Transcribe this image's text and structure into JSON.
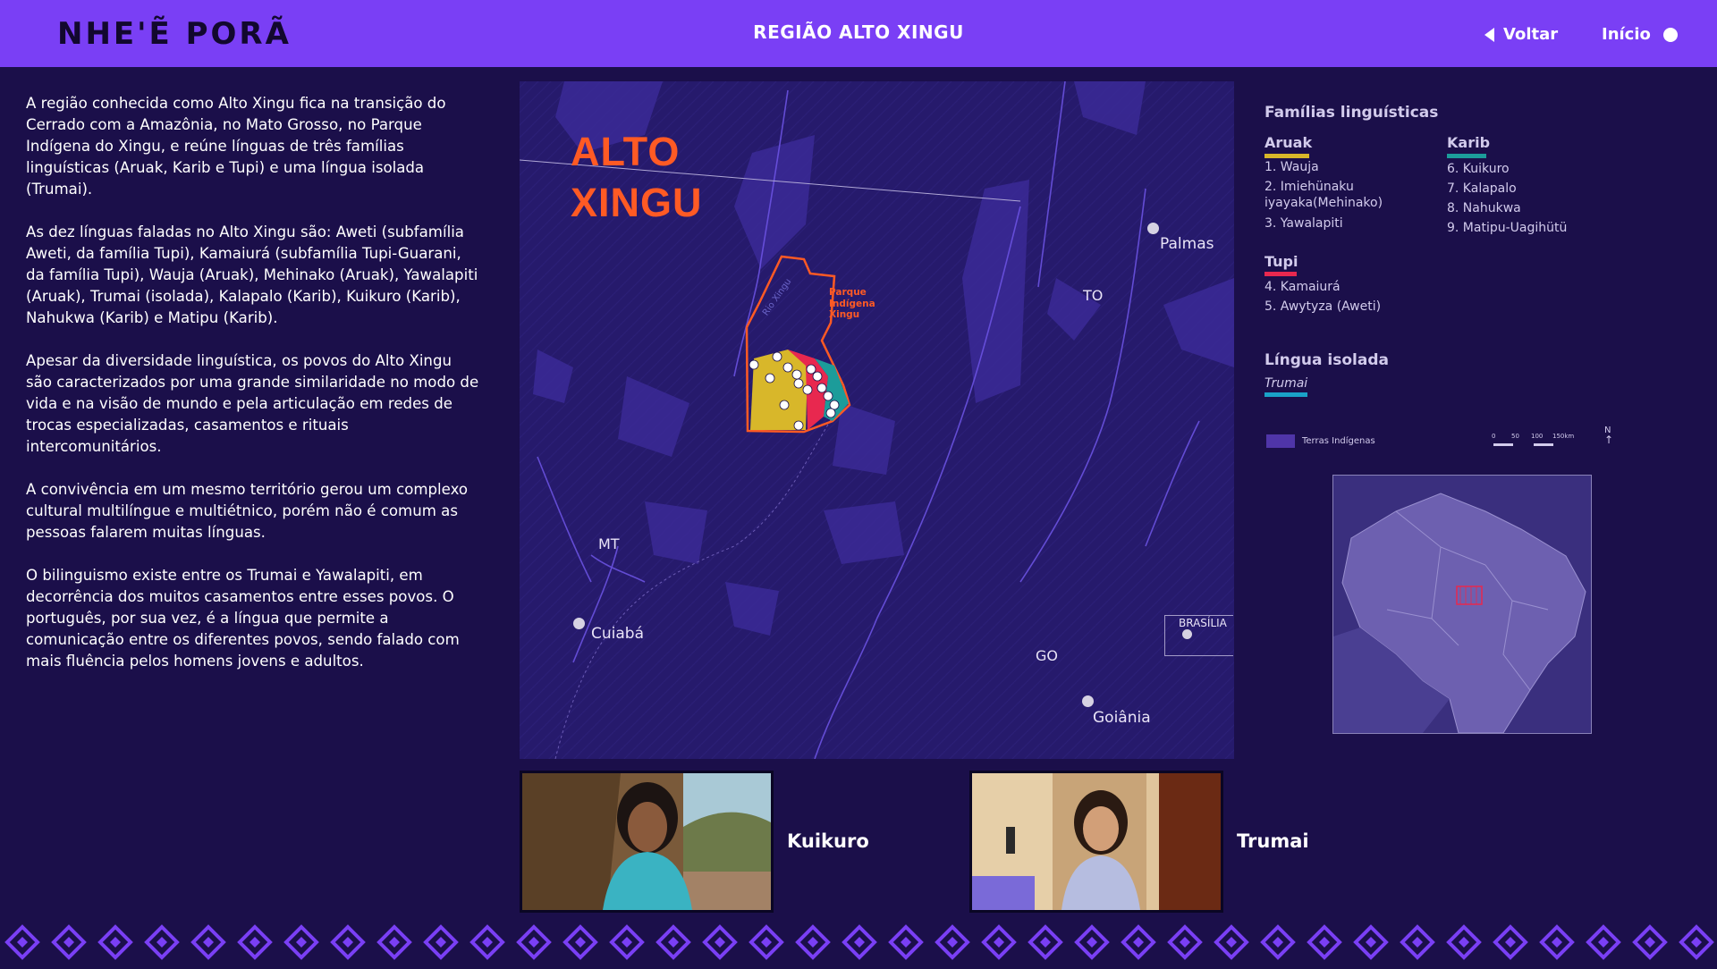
{
  "header": {
    "logo": "NHE'Ẽ PORÃ",
    "title": "REGIÃO ALTO XINGU",
    "back_label": "Voltar",
    "home_label": "Início"
  },
  "description": {
    "paragraphs": [
      "A região conhecida como Alto Xingu fica na transição do Cerrado com a Amazônia, no Mato Grosso, no Parque Indígena do Xingu, e reúne línguas de três famílias linguísticas (Aruak, Karib e Tupi) e uma língua isolada (Trumai).",
      "As dez línguas faladas no Alto Xingu são: Aweti (subfamília Aweti, da família Tupi), Kamaiurá (subfamília Tupi-Guarani, da família Tupi), Wauja (Aruak), Mehinako (Aruak), Yawalapiti (Aruak), Trumai (isolada), Kalapalo (Karib), Kuikuro (Karib), Nahukwa (Karib) e Matipu (Karib).",
      "Apesar da diversidade linguística, os povos do Alto Xingu são caracterizados por uma grande similaridade no modo de vida e na visão de mundo e pela articulação em redes de trocas especializadas, casamentos e rituais intercomunitários.",
      "A convivência em um mesmo território gerou um complexo cultural multilíngue e multiétnico, porém não é comum as pessoas falarem muitas línguas.",
      "O bilinguismo existe entre os Trumai e Yawalapiti, em decorrência dos muitos casamentos entre esses povos. O português, por sua vez, é a língua que permite a comunicação entre os diferentes povos, sendo falado com mais fluência pelos homens jovens e adultos."
    ]
  },
  "map": {
    "title_line1": "ALTO",
    "title_line2": "XINGU",
    "park_label_1": "Parque",
    "park_label_2": "Indígena",
    "park_label_3": "Xingu",
    "river_label": "Rio Xingu",
    "cities": {
      "palmas": "Palmas",
      "cuiaba": "Cuiabá",
      "goiania": "Goiânia",
      "brasilia": "BRASÍLIA"
    },
    "states": {
      "to": "TO",
      "mt": "MT",
      "go": "GO"
    },
    "colors": {
      "aruak": "#d8b72a",
      "tupi": "#e8284f",
      "karib": "#1c9c9a",
      "park_outline": "#ff5a24"
    }
  },
  "legend": {
    "title": "Famílias linguísticas",
    "aruak": {
      "name": "Aruak",
      "color": "#d8b72a",
      "langs": [
        "1. Wauja",
        "2. Imiehünaku",
        "iyayaka(Mehinako)",
        "3. Yawalapiti"
      ]
    },
    "tupi": {
      "name": "Tupi",
      "color": "#e8284f",
      "langs": [
        "4. Kamaiurá",
        "5. Awytyza (Aweti)"
      ]
    },
    "karib": {
      "name": "Karib",
      "color": "#1c9c9a",
      "langs": [
        "6. Kuikuro",
        "7. Kalapalo",
        "8. Nahukwa",
        "9. Matipu-Uagihütü"
      ]
    },
    "isolated_title": "Língua isolada",
    "isolated_lang": "Trumai",
    "isolated_color": "#1aa2c8",
    "ti_label": "Terras Indígenas",
    "scale": [
      "0",
      "50",
      "100",
      "150km"
    ],
    "north": "N"
  },
  "videos": [
    {
      "label": "Kuikuro"
    },
    {
      "label": "Trumai"
    }
  ]
}
